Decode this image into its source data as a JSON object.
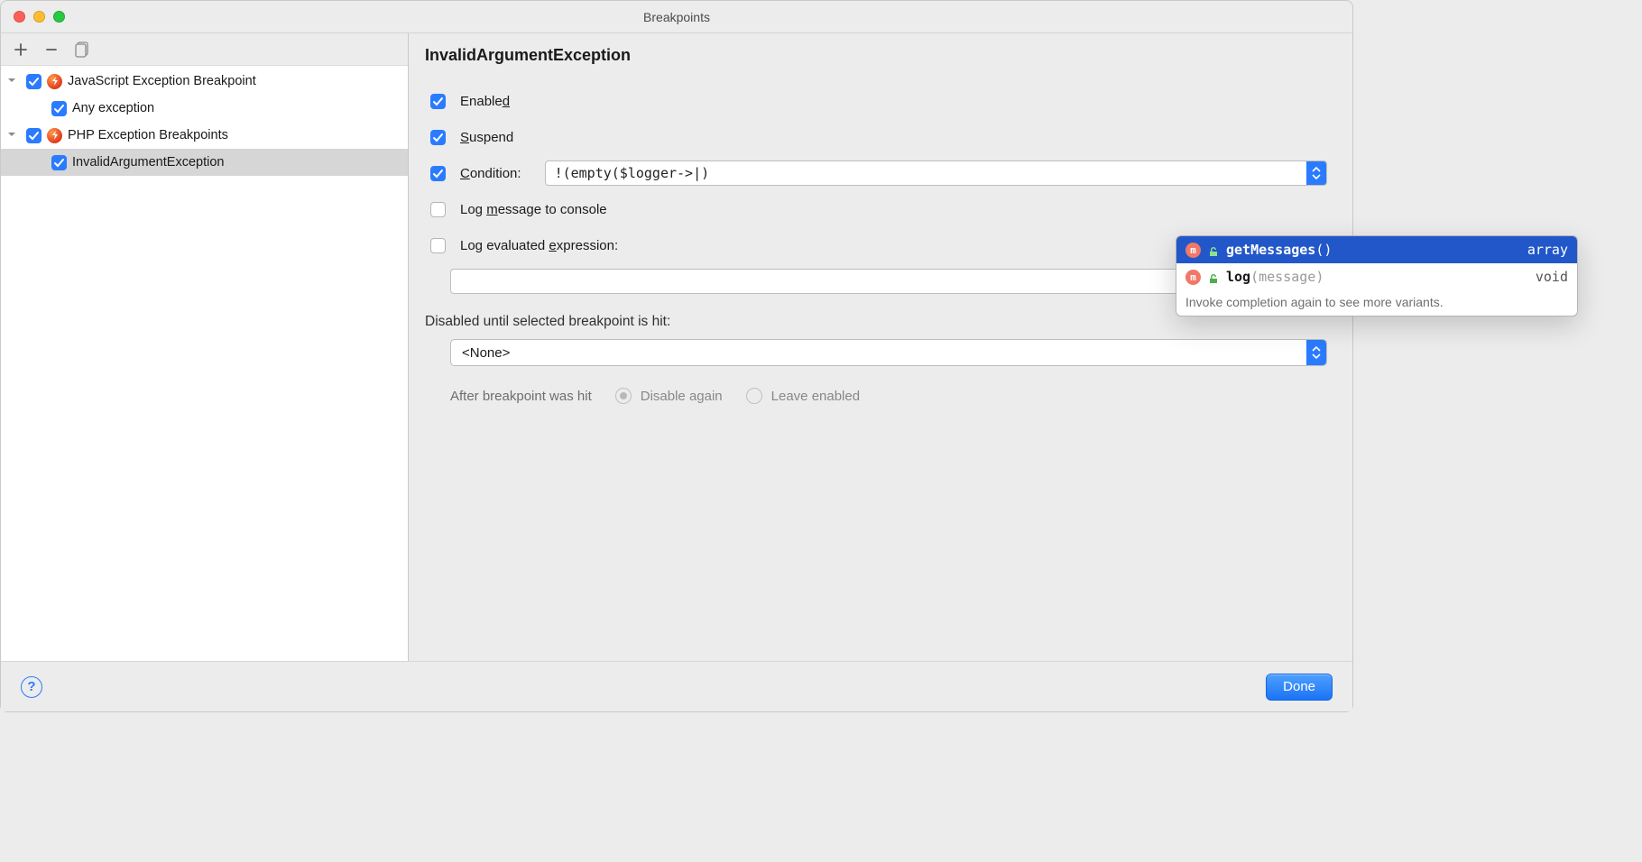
{
  "window": {
    "title": "Breakpoints"
  },
  "toolbar": {
    "add": "+",
    "remove": "−",
    "group_icon": "group-by-file-icon"
  },
  "tree": {
    "groups": [
      {
        "label": "JavaScript Exception Breakpoint",
        "checked": true,
        "children": [
          {
            "label": "Any exception",
            "checked": true,
            "selected": false
          }
        ]
      },
      {
        "label": "PHP Exception Breakpoints",
        "checked": true,
        "children": [
          {
            "label": "InvalidArgumentException",
            "checked": true,
            "selected": true
          }
        ]
      }
    ]
  },
  "details": {
    "title": "InvalidArgumentException",
    "enabled_label": "Enabled",
    "enabled_checked": true,
    "suspend_label": "Suspend",
    "suspend_checked": true,
    "condition_label": "Condition:",
    "condition_checked": true,
    "condition_value": "!(empty($logger->|)",
    "log_console_label": "Log message to console",
    "log_console_checked": false,
    "log_expr_label": "Log evaluated expression:",
    "log_expr_checked": false,
    "log_expr_value": "",
    "disabled_until_label": "Disabled until selected breakpoint is hit:",
    "disabled_until_value": "<None>",
    "after_hit_label": "After breakpoint was hit",
    "after_hit_disable": "Disable again",
    "after_hit_leave": "Leave enabled",
    "after_hit_selected": "disable"
  },
  "completion": {
    "items": [
      {
        "badge": "m",
        "name": "getMessages",
        "params": "()",
        "ret": "array",
        "selected": true
      },
      {
        "badge": "m",
        "name": "log",
        "params": "(message)",
        "ret": "void",
        "selected": false
      }
    ],
    "hint": "Invoke completion again to see more variants."
  },
  "footer": {
    "help": "?",
    "done": "Done"
  }
}
